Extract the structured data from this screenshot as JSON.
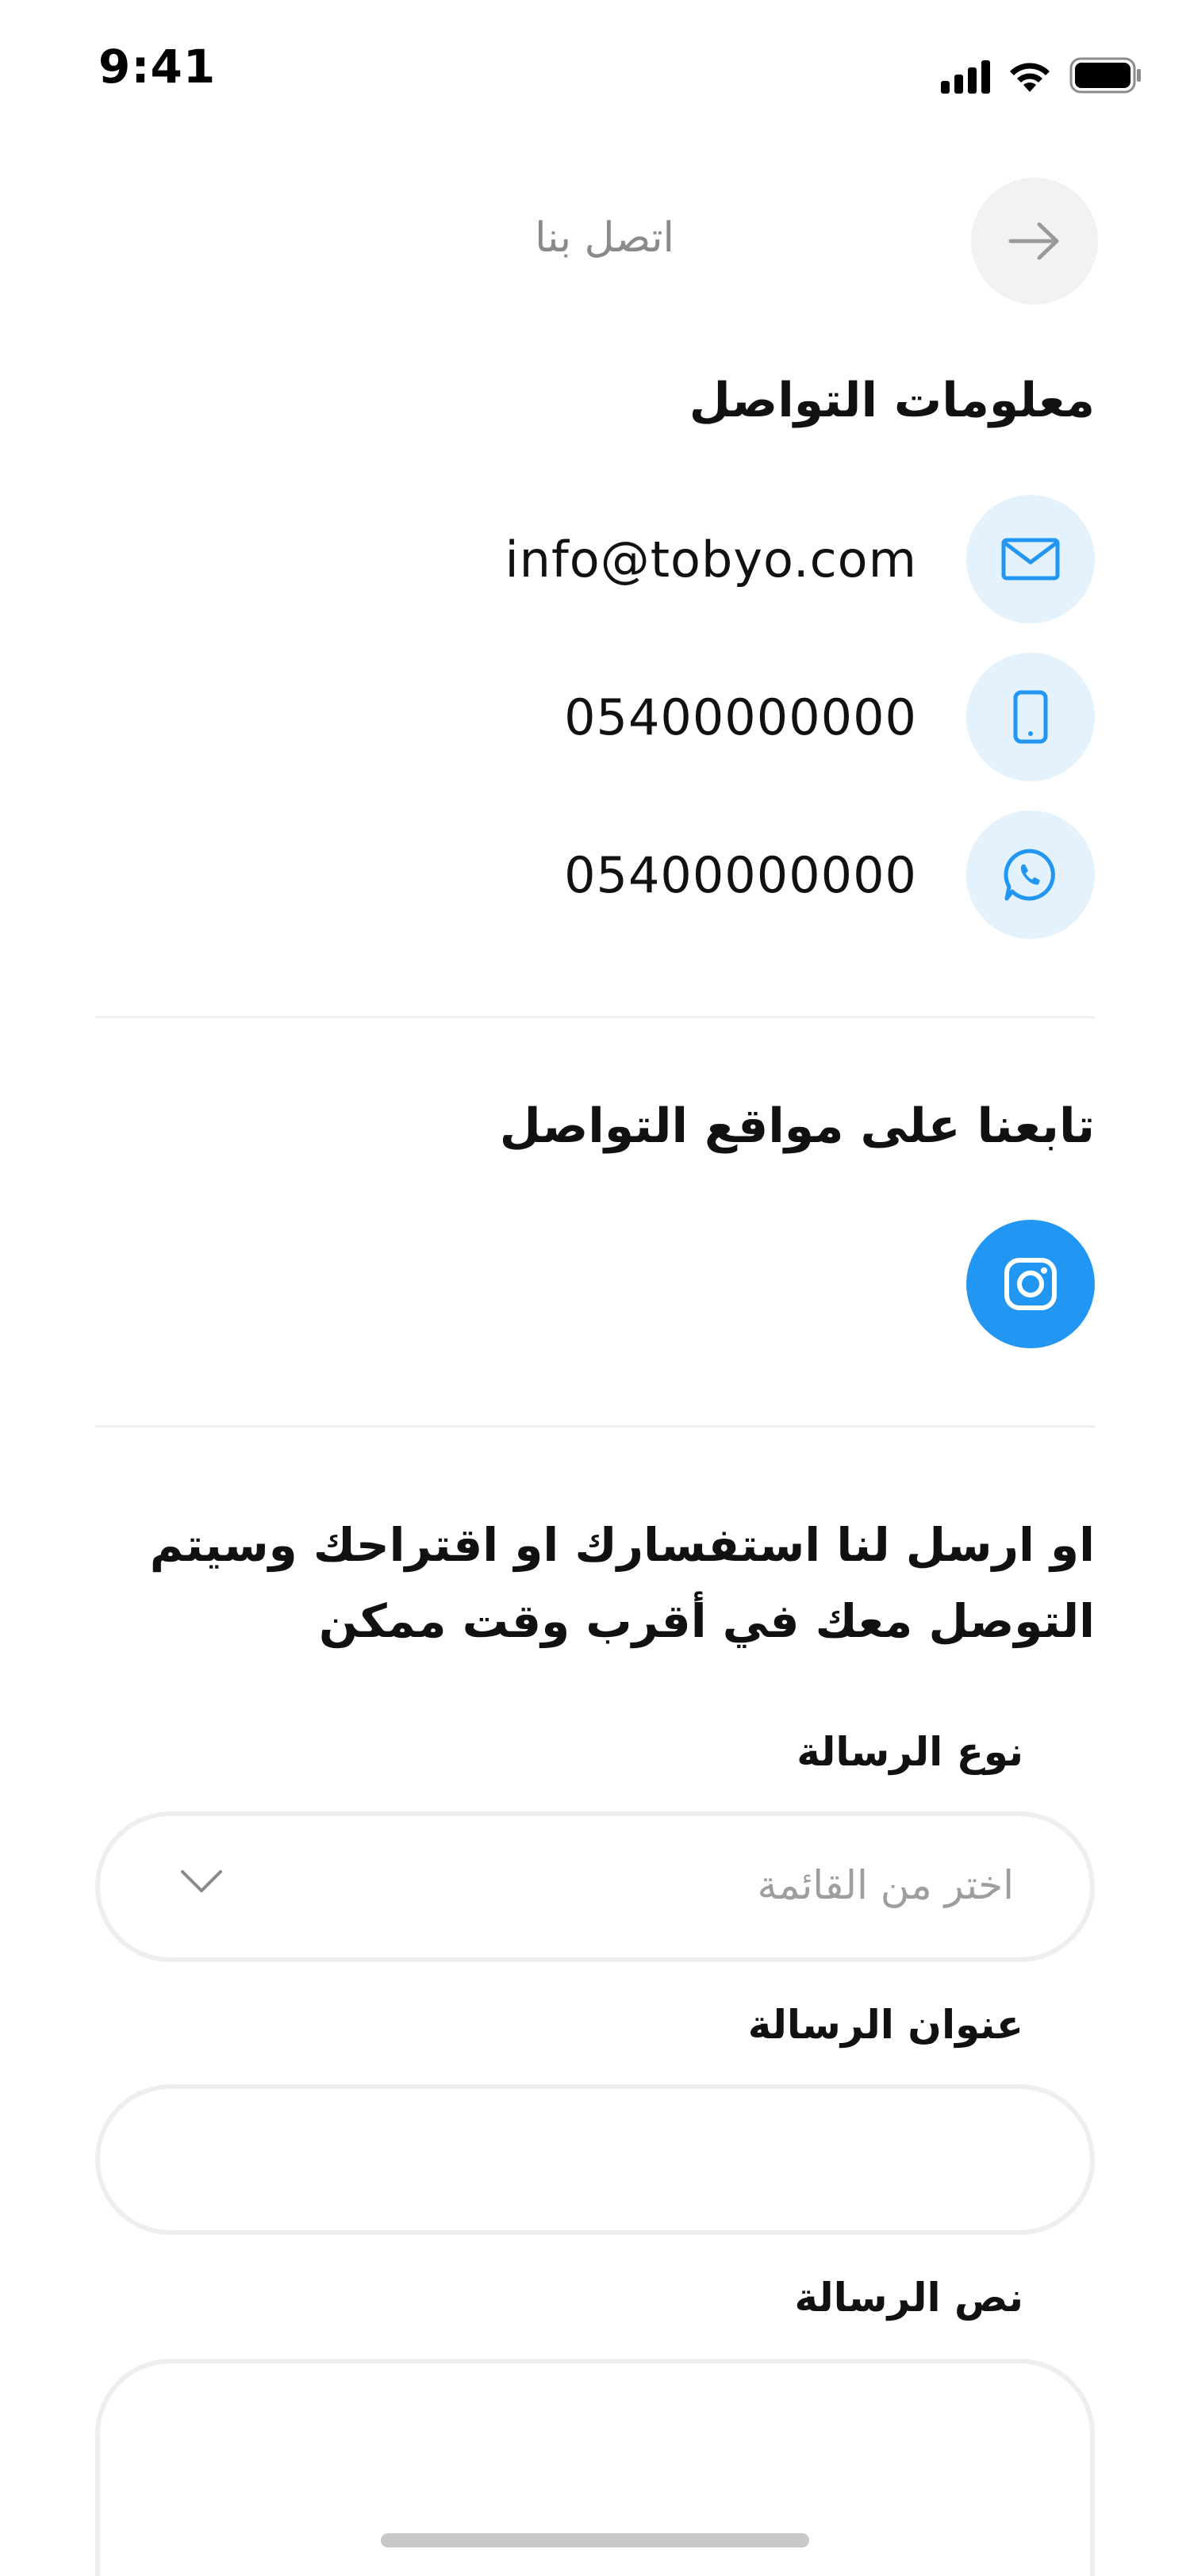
{
  "status_bar": {
    "time": "9:41"
  },
  "header": {
    "title": "اتصل بنا",
    "back_icon": "arrow-right-icon"
  },
  "contact_info": {
    "title": "معلومات التواصل",
    "items": [
      {
        "icon": "mail-icon",
        "value": "info@tobyo.com"
      },
      {
        "icon": "phone-icon",
        "value": "05400000000"
      },
      {
        "icon": "whatsapp-icon",
        "value": "05400000000"
      }
    ]
  },
  "social": {
    "title": "تابعنا على مواقع التواصل",
    "items": [
      {
        "icon": "instagram-icon"
      }
    ]
  },
  "form": {
    "intro": "او ارسل لنا استفسارك او اقتراحك وسيتم التوصل معك في أقرب وقت ممكن",
    "message_type": {
      "label": "نوع الرسالة",
      "placeholder": "اختر من القائمة"
    },
    "message_title": {
      "label": "عنوان الرسالة",
      "value": ""
    },
    "message_body": {
      "label": "نص الرسالة",
      "value": ""
    }
  },
  "colors": {
    "accent": "#2196f3",
    "icon_bg": "#e3f2fd",
    "field_border": "#eeeeee",
    "muted_text": "#9e9e9e"
  }
}
